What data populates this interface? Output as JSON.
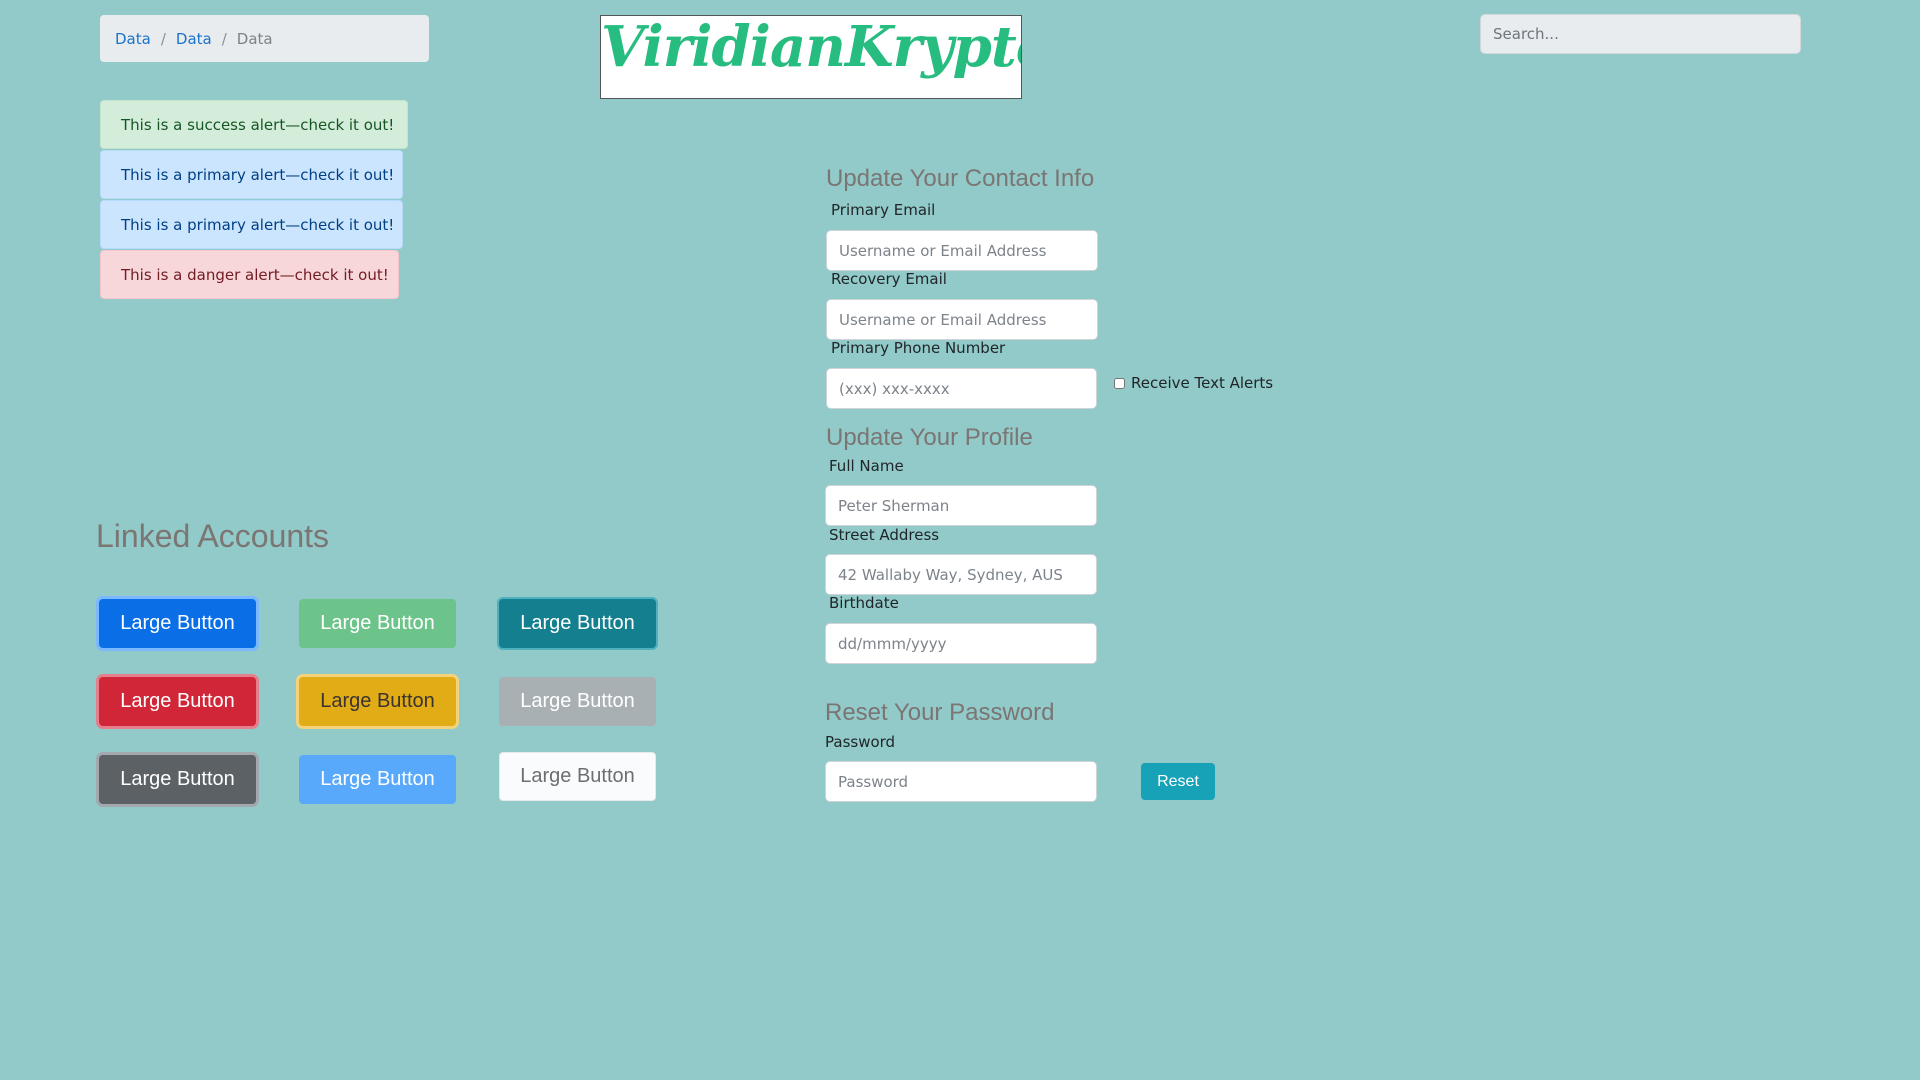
{
  "breadcrumb": {
    "items": [
      "Data",
      "Data"
    ],
    "current": "Data",
    "separator": "/"
  },
  "logo": {
    "text": "ViridianKrypton"
  },
  "search": {
    "placeholder": "Search..."
  },
  "alerts": {
    "success": "This is a success alert—check it out!",
    "primary_1": "This is a primary alert—check it out!",
    "primary_2": "This is a primary alert—check it out!",
    "danger": "This is a danger alert—check it out!"
  },
  "linked_accounts": {
    "title": "Linked Accounts",
    "buttons": [
      "Large Button",
      "Large Button",
      "Large Button",
      "Large Button",
      "Large Button",
      "Large Button",
      "Large Button",
      "Large Button",
      "Large Button"
    ]
  },
  "contact": {
    "heading": "Update Your Contact Info",
    "primary_email_label": "Primary Email",
    "primary_email_placeholder": "Username or Email Address",
    "recovery_email_label": "Recovery Email",
    "recovery_email_placeholder": "Username or Email Address",
    "phone_label": "Primary Phone Number",
    "phone_placeholder": "(xxx) xxx-xxxx",
    "text_alerts_label": "Receive Text Alerts"
  },
  "profile": {
    "heading": "Update Your Profile",
    "full_name_label": "Full Name",
    "full_name_placeholder": "Peter Sherman",
    "address_label": "Street Address",
    "address_placeholder": "42 Wallaby Way, Sydney, AUS",
    "birthdate_label": "Birthdate",
    "birthdate_placeholder": "dd/mmm/yyyy"
  },
  "password": {
    "heading": "Reset Your Password",
    "label": "Password",
    "placeholder": "Password",
    "reset_label": "Reset"
  },
  "colors": {
    "background": "#91cac8",
    "logo": "#27bc80",
    "heading": "#7b7574",
    "reset_button": "#17a2b8"
  }
}
